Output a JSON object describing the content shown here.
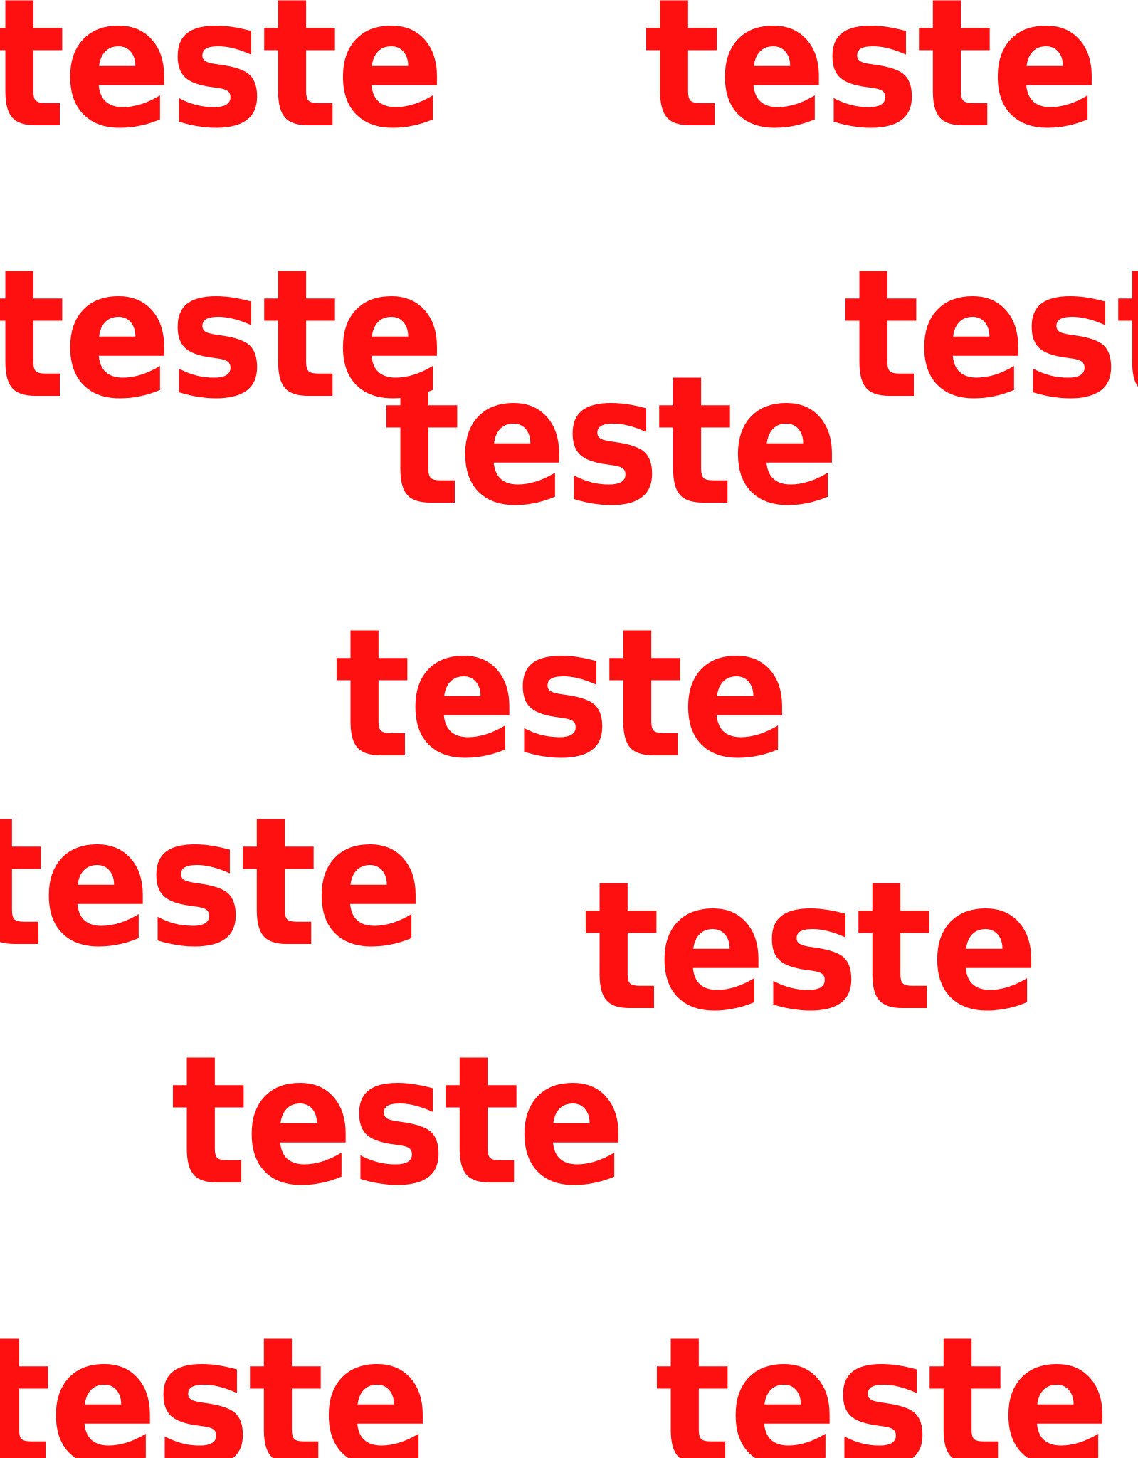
{
  "pattern": {
    "text_color": "#ff1010",
    "background_color": "#ffffff",
    "words": [
      {
        "text": "teste"
      },
      {
        "text": "teste"
      },
      {
        "text": "teste"
      },
      {
        "text": "teste"
      },
      {
        "text": "teste"
      },
      {
        "text": "teste"
      },
      {
        "text": "teste"
      },
      {
        "text": "teste"
      },
      {
        "text": "teste"
      },
      {
        "text": "teste"
      },
      {
        "text": "teste"
      }
    ]
  }
}
